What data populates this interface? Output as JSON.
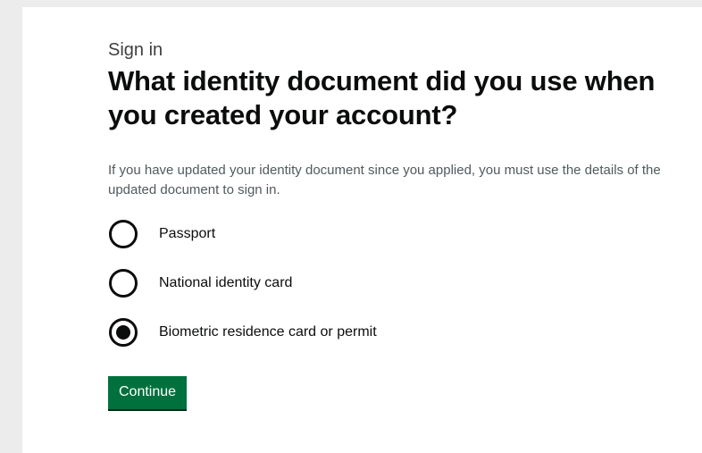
{
  "page": {
    "caption": "Sign in",
    "heading": "What identity document did you use when you created your account?",
    "hint": "If you have updated your identity document since you applied, you must use the details of the updated document to sign in.",
    "options": [
      {
        "label": "Passport",
        "selected": false
      },
      {
        "label": "National identity card",
        "selected": false
      },
      {
        "label": "Biometric residence card or permit",
        "selected": true
      }
    ],
    "continue_label": "Continue"
  },
  "colors": {
    "page_background": "#ececec",
    "panel_background": "#ffffff",
    "text": "#0b0c0c",
    "hint_text": "#505a5f",
    "button_background": "#00703c",
    "button_text": "#ffffff"
  }
}
